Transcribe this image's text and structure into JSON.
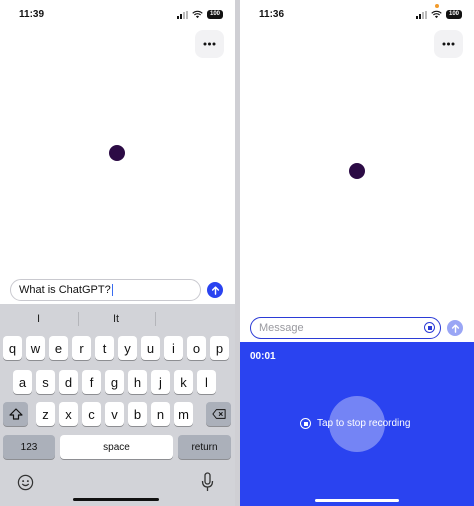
{
  "left": {
    "status": {
      "time": "11:39",
      "battery": "100"
    },
    "composer": {
      "text": "What is ChatGPT?"
    },
    "keyboard": {
      "suggestions": [
        "I",
        "It",
        ""
      ],
      "row1": [
        "q",
        "w",
        "e",
        "r",
        "t",
        "y",
        "u",
        "i",
        "o",
        "p"
      ],
      "row2": [
        "a",
        "s",
        "d",
        "f",
        "g",
        "h",
        "j",
        "k",
        "l"
      ],
      "row3": [
        "z",
        "x",
        "c",
        "v",
        "b",
        "n",
        "m"
      ],
      "numbers_label": "123",
      "space_label": "space",
      "return_label": "return"
    }
  },
  "right": {
    "status": {
      "time": "11:36",
      "battery": "100"
    },
    "composer": {
      "placeholder": "Message"
    },
    "recording": {
      "timer": "00:01",
      "label": "Tap to stop recording"
    }
  },
  "colors": {
    "accent_blue": "#2a43f0",
    "voice_dot": "#2c0b45",
    "send_light": "#9aa6f5",
    "mic_dot": "#f29b2c"
  },
  "icons": [
    "signal-icon",
    "wifi-icon",
    "more-icon",
    "send-arrow-icon",
    "shift-icon",
    "delete-icon",
    "emoji-icon",
    "mic-icon",
    "stop-icon"
  ]
}
